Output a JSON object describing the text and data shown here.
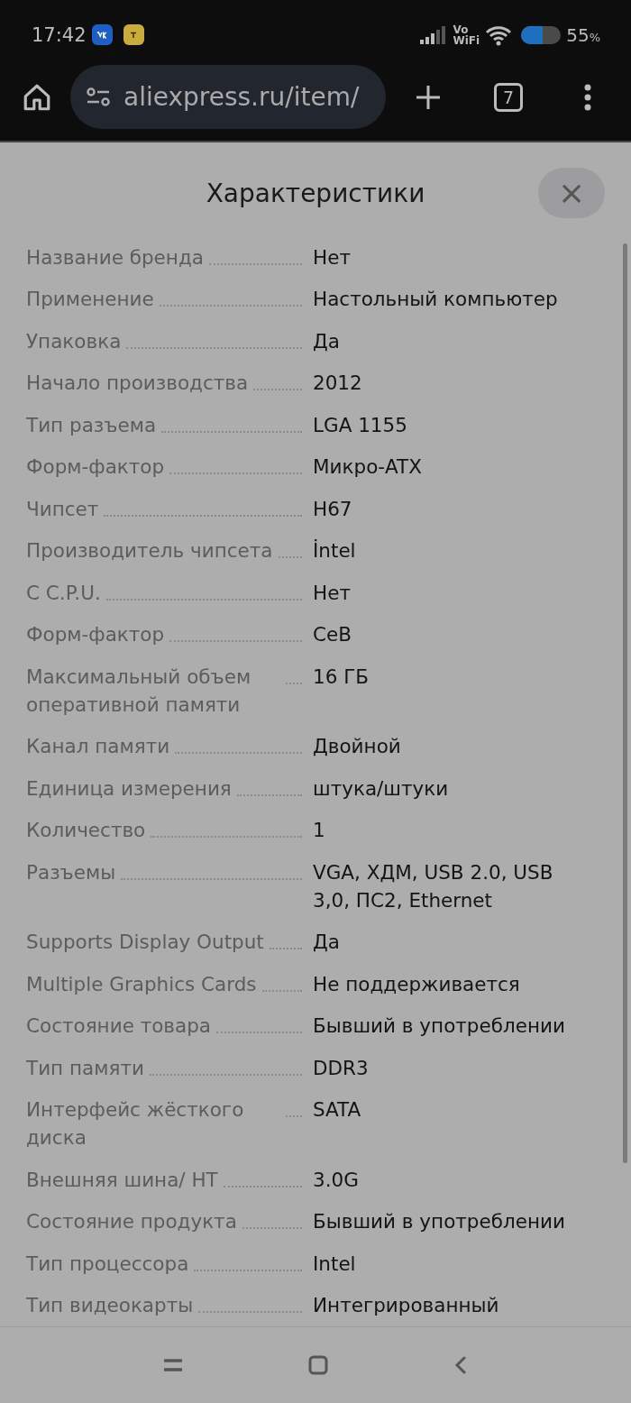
{
  "status_bar": {
    "time": "17:42",
    "network_label_top": "Vo",
    "network_label_bottom": "WiFi",
    "battery": "55",
    "battery_unit": "%"
  },
  "browser": {
    "url": "aliexpress.ru/item/",
    "tab_count": "7"
  },
  "sheet": {
    "title": "Характеристики",
    "close": "×",
    "rows": [
      {
        "label": "Название бренда",
        "value": "Нет"
      },
      {
        "label": "Применение",
        "value": "Настольный компьютер"
      },
      {
        "label": "Упаковка",
        "value": "Да"
      },
      {
        "label": "Начало производства",
        "value": "2012"
      },
      {
        "label": "Тип разъема",
        "value": "LGA 1155"
      },
      {
        "label": "Форм-фактор",
        "value": "Микро-ATX"
      },
      {
        "label": "Чипсет",
        "value": "H67"
      },
      {
        "label": "Производитель чипсета",
        "value": "İntel"
      },
      {
        "label": "С C.P.U.",
        "value": "Нет"
      },
      {
        "label": "Форм-фактор",
        "value": "CeB"
      },
      {
        "label": "Максимальный объем оперативной памяти",
        "value": "16 ГБ"
      },
      {
        "label": "Канал памяти",
        "value": "Двойной"
      },
      {
        "label": "Единица измерения",
        "value": "штука/штуки"
      },
      {
        "label": "Количество",
        "value": "1"
      },
      {
        "label": "Разъемы",
        "value": "VGA, ХДМ, USB 2.0, USB 3,0, ПС2, Ethernet"
      },
      {
        "label": "Supports Display Output",
        "value": "Да"
      },
      {
        "label": "Multiple Graphics Cards",
        "value": "Не поддерживается"
      },
      {
        "label": "Состояние товара",
        "value": "Бывший в употреблении"
      },
      {
        "label": "Тип памяти",
        "value": "DDR3"
      },
      {
        "label": "Интерфейс жёсткого диска",
        "value": "SATA"
      },
      {
        "label": "Внешняя шина/ HT",
        "value": "3.0G"
      },
      {
        "label": "Состояние продукта",
        "value": "Бывший в употреблении"
      },
      {
        "label": "Тип процессора",
        "value": "Intel"
      },
      {
        "label": "Тип видеокарты",
        "value": "Интегрированный"
      }
    ]
  }
}
